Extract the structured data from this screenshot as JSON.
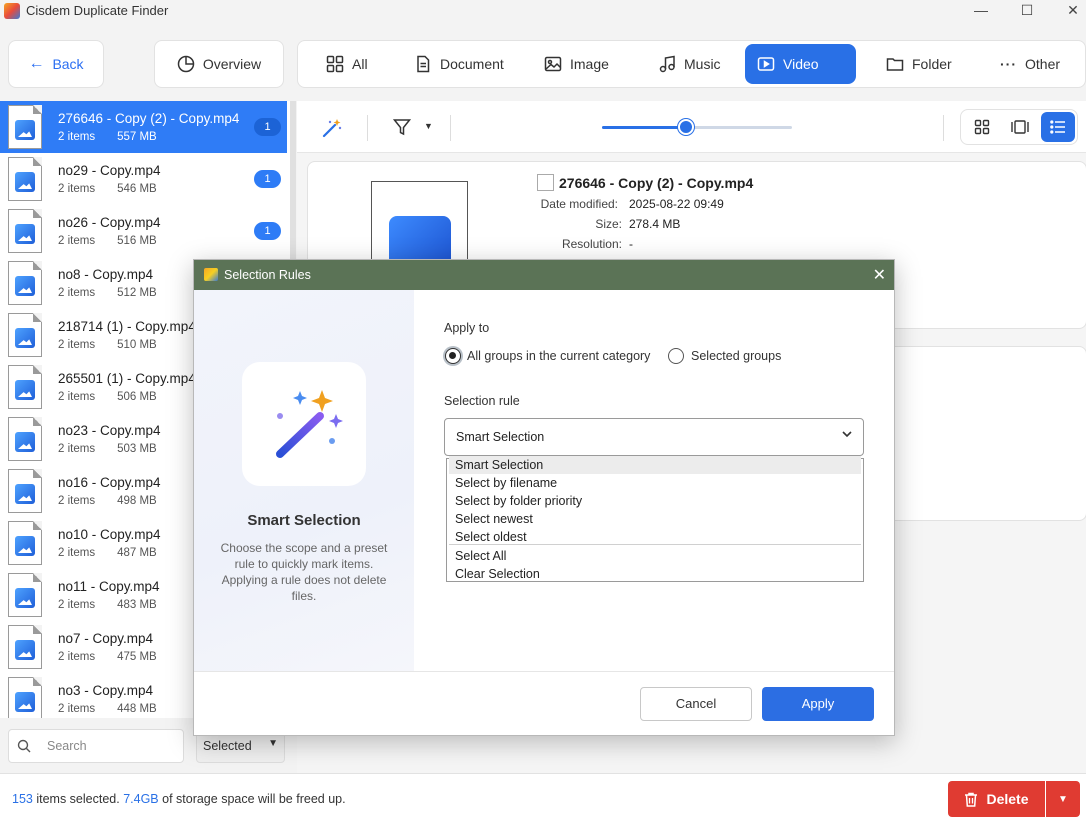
{
  "window": {
    "title": "Cisdem Duplicate Finder",
    "controls": [
      "—",
      "☐",
      "✕"
    ]
  },
  "toolbar": {
    "back_label": "Back",
    "overview_label": "Overview",
    "categories": [
      "All",
      "Document",
      "Image",
      "Music",
      "Video",
      "Folder",
      "Other"
    ],
    "active_category": "Video"
  },
  "groups": [
    {
      "name": "276646 - Copy (2) - Copy.mp4",
      "items": "2 items",
      "size": "557 MB",
      "badge": "1",
      "selected": true
    },
    {
      "name": "no29 - Copy.mp4",
      "items": "2 items",
      "size": "546 MB",
      "badge": "1"
    },
    {
      "name": "no26 - Copy.mp4",
      "items": "2 items",
      "size": "516 MB",
      "badge": "1"
    },
    {
      "name": "no8 - Copy.mp4",
      "items": "2 items",
      "size": "512 MB"
    },
    {
      "name": "218714 (1) - Copy.mp4",
      "items": "2 items",
      "size": "510 MB"
    },
    {
      "name": "265501 (1) - Copy.mp4",
      "items": "2 items",
      "size": "506 MB"
    },
    {
      "name": "no23 - Copy.mp4",
      "items": "2 items",
      "size": "503 MB"
    },
    {
      "name": "no16 - Copy.mp4",
      "items": "2 items",
      "size": "498 MB"
    },
    {
      "name": "no10 - Copy.mp4",
      "items": "2 items",
      "size": "487 MB"
    },
    {
      "name": "no11 - Copy.mp4",
      "items": "2 items",
      "size": "483 MB"
    },
    {
      "name": "no7 - Copy.mp4",
      "items": "2 items",
      "size": "475 MB"
    },
    {
      "name": "no3 - Copy.mp4",
      "items": "2 items",
      "size": "448 MB"
    }
  ],
  "search": {
    "placeholder": "Search",
    "filter_value": "Selected"
  },
  "thumbnail_size": 0.44,
  "detail": {
    "file_name": "276646 - Copy (2) - Copy.mp4",
    "date_label": "Date modified:",
    "date_value": "2025-08-22 09:49",
    "size_label": "Size:",
    "size_value": "278.4 MB",
    "resolution_label": "Resolution:",
    "resolution_value": "-"
  },
  "status": {
    "count": "153",
    "count_suffix": "items selected.",
    "space": "7.4GB",
    "space_suffix": "of storage space will be freed up."
  },
  "delete_label": "Delete",
  "modal": {
    "title": "Selection Rules",
    "left_title": "Smart Selection",
    "left_desc": "Choose the scope and a preset rule to quickly mark items. Applying a rule does not delete files.",
    "apply_to_label": "Apply to",
    "radio_all": "All groups in the current category",
    "radio_selected": "Selected groups",
    "rule_label": "Selection rule",
    "rule_value": "Smart Selection",
    "options": [
      "Smart Selection",
      "Select by filename",
      "Select by folder priority",
      "Select newest",
      "Select oldest",
      "Select All",
      "Clear Selection"
    ],
    "cancel_label": "Cancel",
    "apply_label": "Apply"
  }
}
